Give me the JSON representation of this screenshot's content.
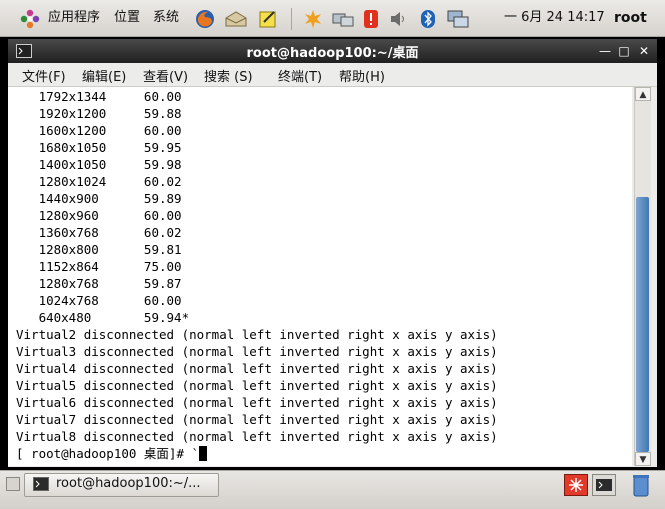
{
  "top_panel": {
    "applications": "应用程序",
    "places": "位置",
    "system": "系统",
    "clock": "一 6月 24 14:17",
    "user": "root"
  },
  "window": {
    "title": "root@hadoop100:~/桌面",
    "menu": [
      "文件(F)",
      "编辑(E)",
      "查看(V)",
      "搜索 (S)",
      "终端(T)",
      "帮助(H)"
    ]
  },
  "terminal": {
    "lines": [
      "   1792x1344     60.00",
      "   1920x1200     59.88",
      "   1600x1200     60.00",
      "   1680x1050     59.95",
      "   1400x1050     59.98",
      "   1280x1024     60.02",
      "   1440x900      59.89",
      "   1280x960      60.00",
      "   1360x768      60.02",
      "   1280x800      59.81",
      "   1152x864      75.00",
      "   1280x768      59.87",
      "   1024x768      60.00",
      "   640x480       59.94*",
      "Virtual2 disconnected (normal left inverted right x axis y axis)",
      "Virtual3 disconnected (normal left inverted right x axis y axis)",
      "Virtual4 disconnected (normal left inverted right x axis y axis)",
      "Virtual5 disconnected (normal left inverted right x axis y axis)",
      "Virtual6 disconnected (normal left inverted right x axis y axis)",
      "Virtual7 disconnected (normal left inverted right x axis y axis)",
      "Virtual8 disconnected (normal left inverted right x axis y axis)"
    ],
    "prompt": "[ root@hadoop100 桌面]# `"
  },
  "taskbar": {
    "task_label": "root@hadoop100:~/..."
  }
}
